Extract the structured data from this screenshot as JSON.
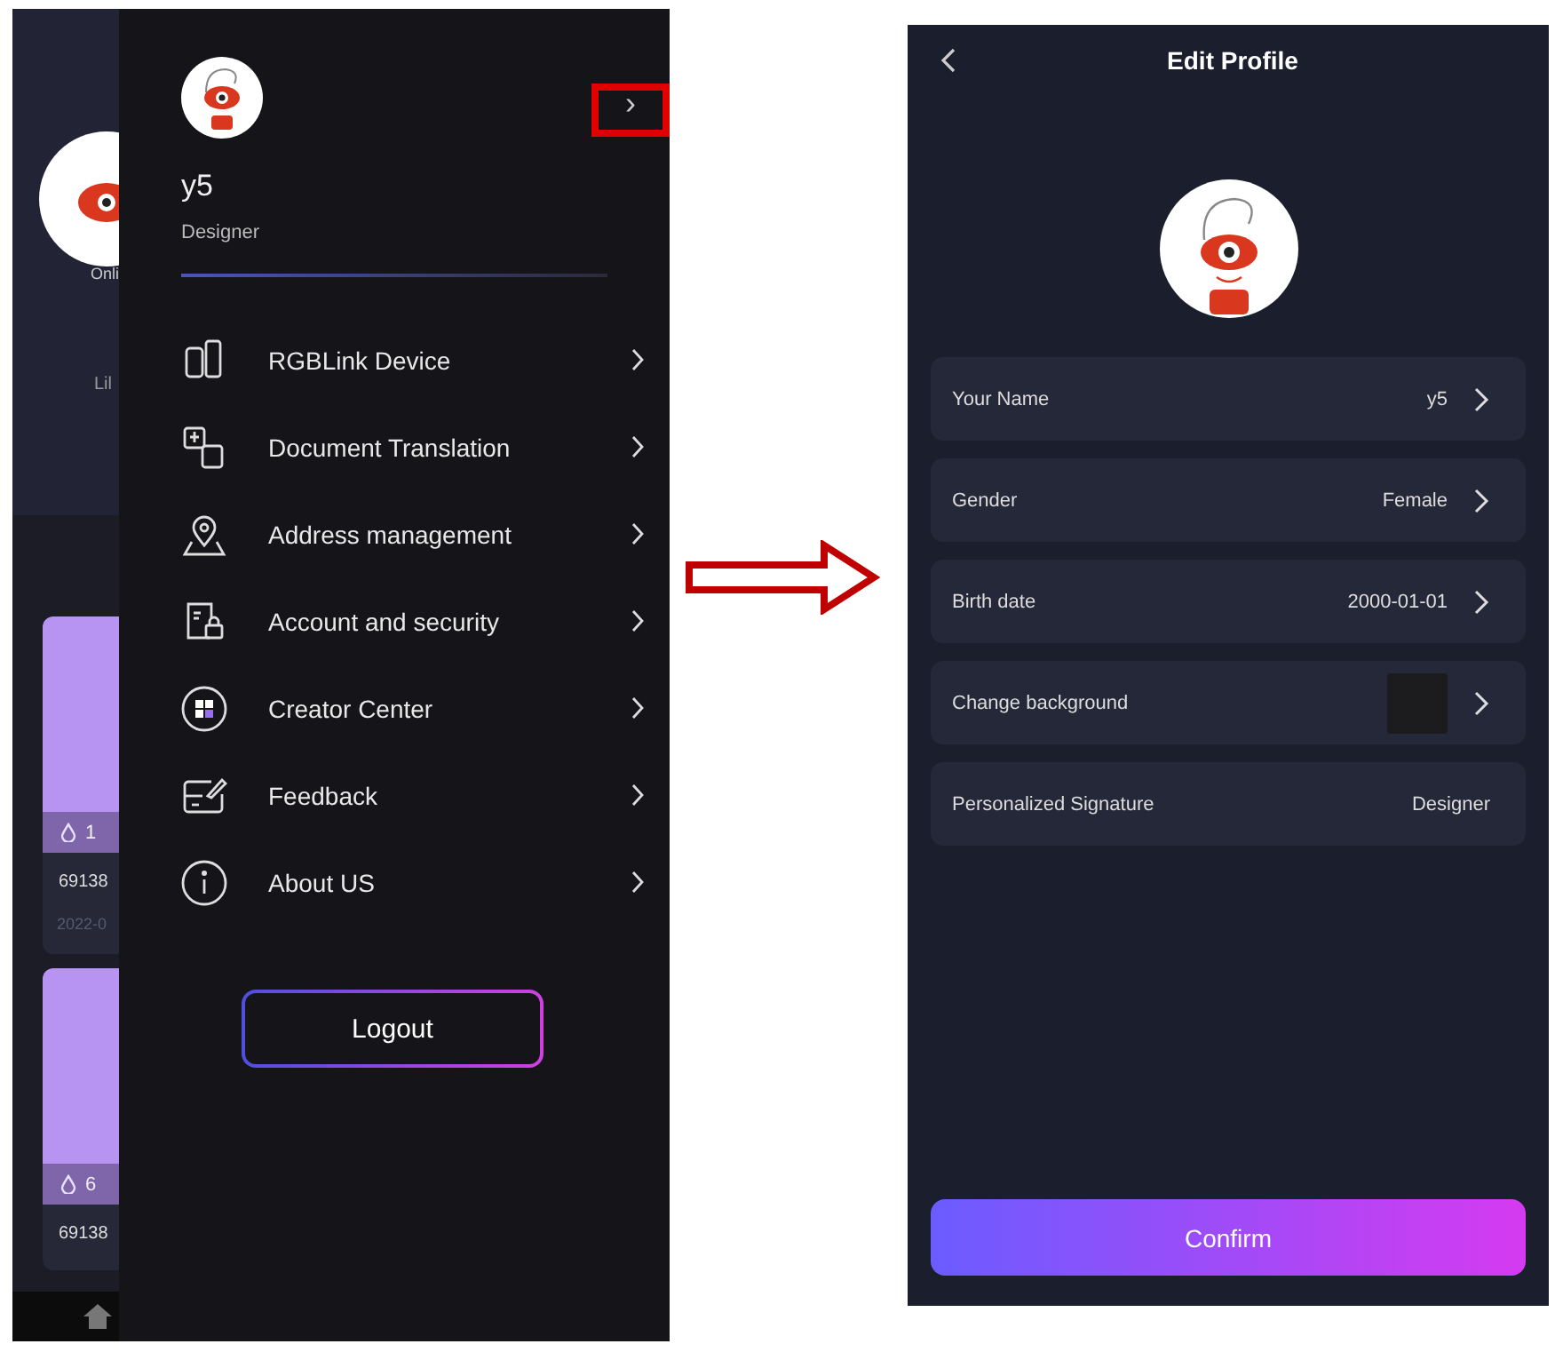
{
  "background_screen": {
    "status": "Onli",
    "name": "Lil",
    "cards": [
      {
        "count": "1",
        "id": "69138",
        "date": "2022-0"
      },
      {
        "count": "6",
        "id": "69138"
      }
    ]
  },
  "drawer": {
    "user": {
      "name": "y5",
      "role": "Designer"
    },
    "profile_chevron": "›",
    "profile_chevron_highlighted": true,
    "menu": [
      {
        "label": "RGBLink Device"
      },
      {
        "label": "Document Translation"
      },
      {
        "label": "Address management"
      },
      {
        "label": "Account and security"
      },
      {
        "label": "Creator Center"
      },
      {
        "label": "Feedback"
      },
      {
        "label": "About US"
      }
    ],
    "logout": "Logout"
  },
  "edit_profile": {
    "title": "Edit Profile",
    "fields": [
      {
        "kind": "text",
        "label": "Your Name",
        "value": "y5",
        "chevron": true
      },
      {
        "kind": "text",
        "label": "Gender",
        "value": "Female",
        "chevron": true
      },
      {
        "kind": "text",
        "label": "Birth date",
        "value": "2000-01-01",
        "chevron": true
      },
      {
        "kind": "swatch",
        "label": "Change background",
        "color": "#1c1c1e",
        "chevron": true
      },
      {
        "kind": "text",
        "label": "Personalized Signature",
        "value": "Designer",
        "chevron": false
      }
    ],
    "confirm": "Confirm"
  }
}
